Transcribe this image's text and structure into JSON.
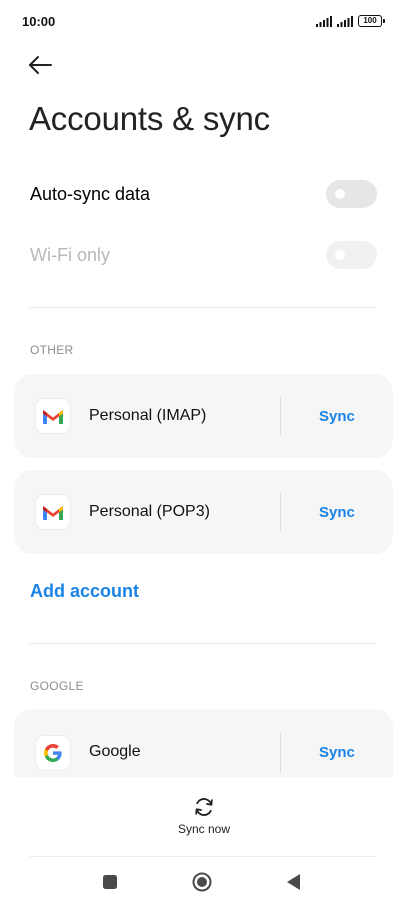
{
  "status_bar": {
    "time": "10:00",
    "battery": "100",
    "icons": [
      "signal-icon",
      "signal-icon",
      "battery-icon"
    ]
  },
  "header": {
    "back_icon": "arrow-left-icon",
    "title": "Accounts & sync"
  },
  "settings": {
    "auto_sync": {
      "label": "Auto-sync data",
      "enabled": false
    },
    "wifi_only": {
      "label": "Wi-Fi only",
      "enabled": false,
      "disabled": true
    }
  },
  "sections": {
    "other": {
      "header": "OTHER",
      "accounts": [
        {
          "name": "Personal (IMAP)",
          "action": "Sync",
          "icon": "gmail-icon"
        },
        {
          "name": "Personal (POP3)",
          "action": "Sync",
          "icon": "gmail-icon"
        }
      ],
      "add_account": "Add account"
    },
    "google": {
      "header": "GOOGLE",
      "accounts": [
        {
          "name": "Google",
          "action": "Sync",
          "icon": "google-icon"
        }
      ]
    }
  },
  "bottom": {
    "sync_now_label": "Sync now",
    "sync_icon": "sync-icon"
  },
  "nav_bar": {
    "icons": [
      "recent-apps-icon",
      "home-icon",
      "back-triangle-icon"
    ]
  },
  "colors": {
    "accent": "#1a84e6",
    "card_bg": "#f6f6f6",
    "toggle_off": "#e6e6e6",
    "disabled_text": "#b9b9b9"
  }
}
